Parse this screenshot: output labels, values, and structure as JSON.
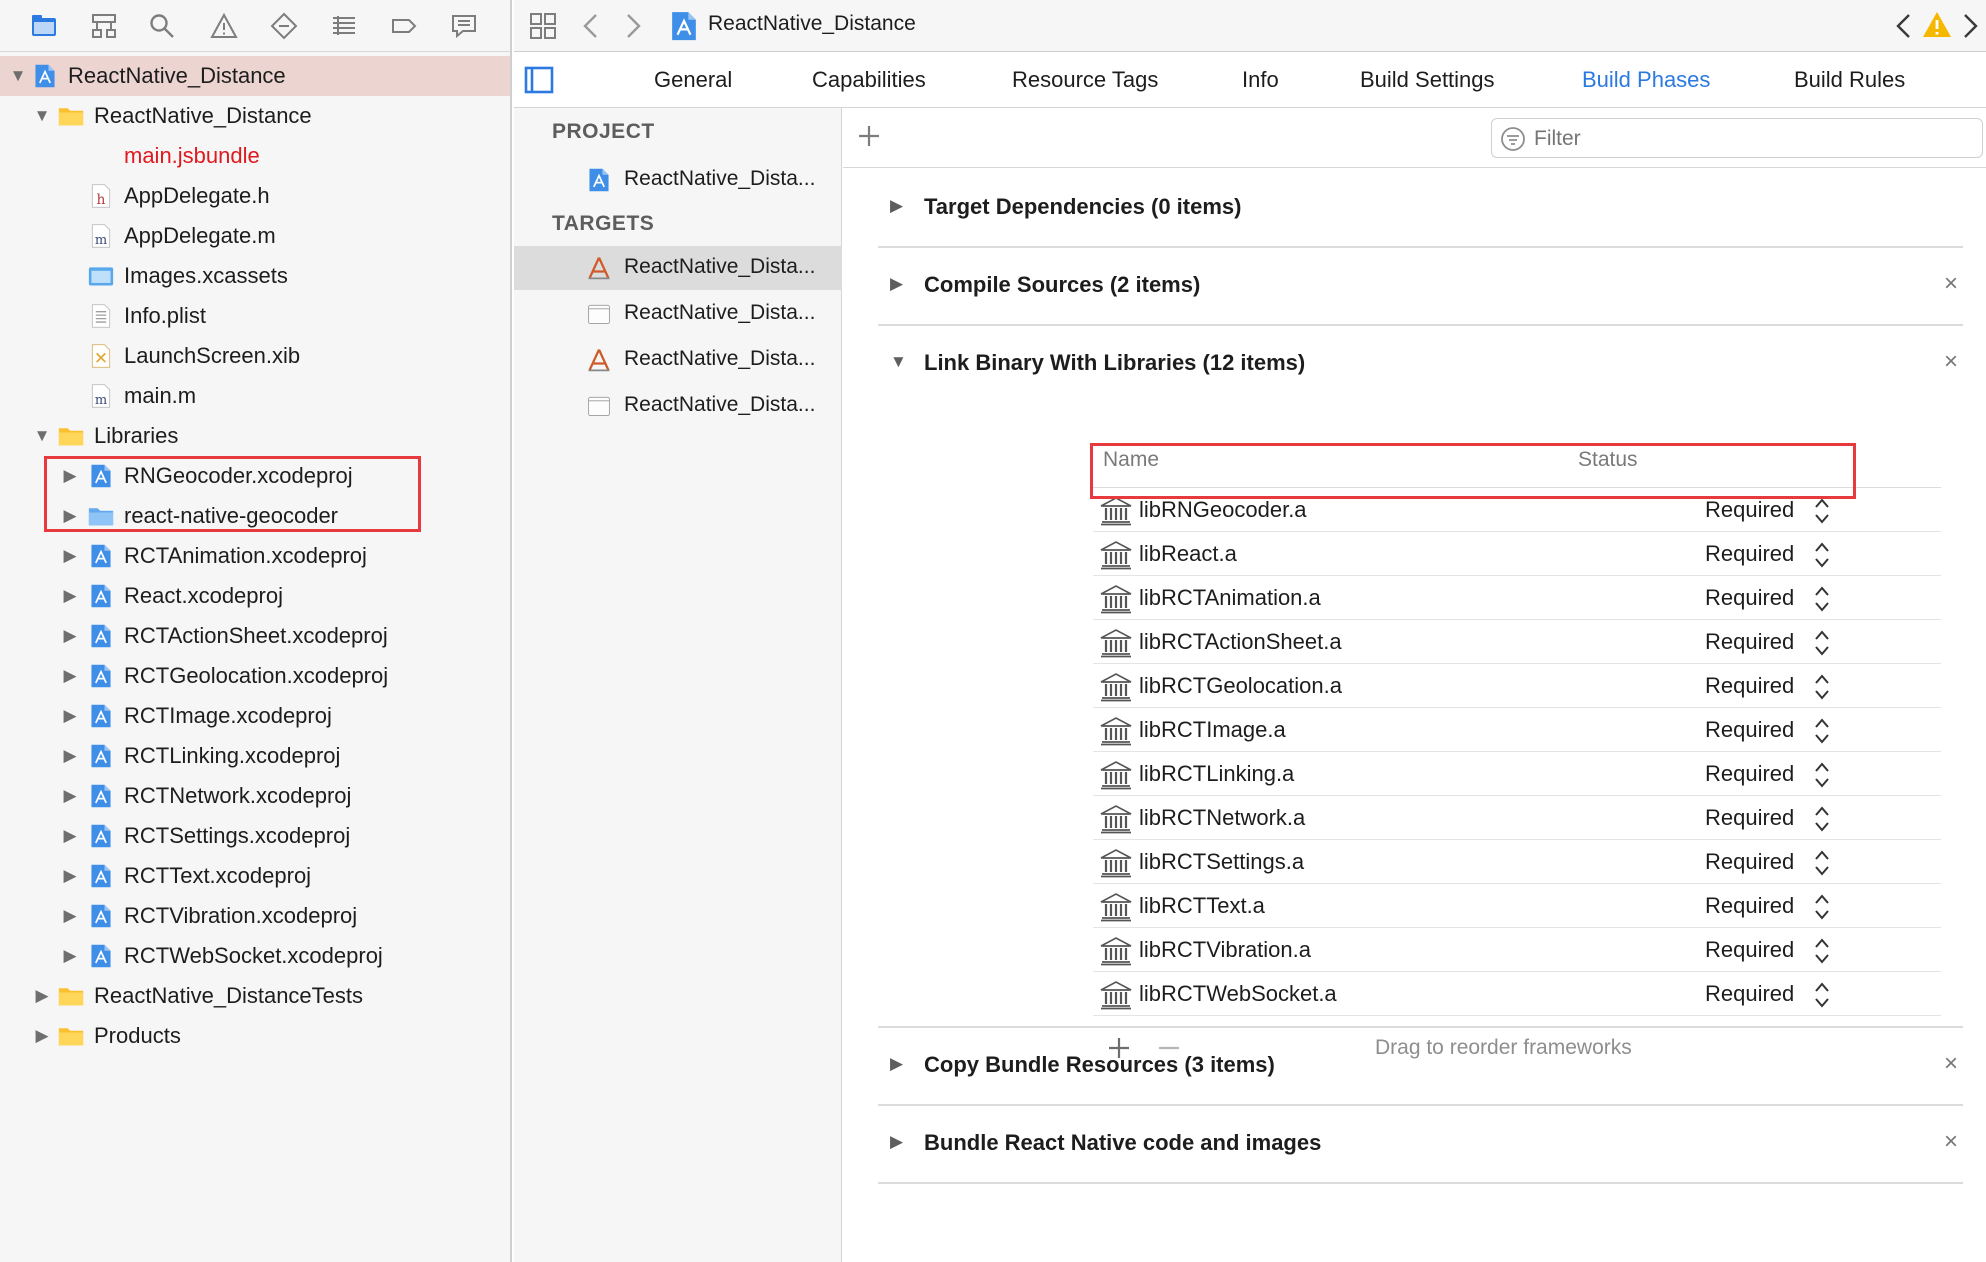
{
  "navigator": {
    "tree": [
      {
        "label": "ReactNative_Distance",
        "icon": "project-icon",
        "depth": 0,
        "disclosure": "down",
        "selected": true
      },
      {
        "label": "ReactNative_Distance",
        "icon": "folder-icon",
        "depth": 1,
        "disclosure": "down"
      },
      {
        "label": "main.jsbundle",
        "icon": "none",
        "depth": 2,
        "red": true
      },
      {
        "label": "AppDelegate.h",
        "icon": "header-file-icon",
        "depth": 2
      },
      {
        "label": "AppDelegate.m",
        "icon": "objc-file-icon",
        "depth": 2
      },
      {
        "label": "Images.xcassets",
        "icon": "asset-catalog-icon",
        "depth": 2
      },
      {
        "label": "Info.plist",
        "icon": "plist-file-icon",
        "depth": 2
      },
      {
        "label": "LaunchScreen.xib",
        "icon": "xib-file-icon",
        "depth": 2
      },
      {
        "label": "main.m",
        "icon": "objc-file-icon",
        "depth": 2
      },
      {
        "label": "Libraries",
        "icon": "folder-icon",
        "depth": 1,
        "disclosure": "down"
      },
      {
        "label": "RNGeocoder.xcodeproj",
        "icon": "project-icon",
        "depth": 2,
        "disclosure": "right"
      },
      {
        "label": "react-native-geocoder",
        "icon": "blue-folder-icon",
        "depth": 2,
        "disclosure": "right"
      },
      {
        "label": "RCTAnimation.xcodeproj",
        "icon": "project-icon",
        "depth": 2,
        "disclosure": "right"
      },
      {
        "label": "React.xcodeproj",
        "icon": "project-icon",
        "depth": 2,
        "disclosure": "right"
      },
      {
        "label": "RCTActionSheet.xcodeproj",
        "icon": "project-icon",
        "depth": 2,
        "disclosure": "right"
      },
      {
        "label": "RCTGeolocation.xcodeproj",
        "icon": "project-icon",
        "depth": 2,
        "disclosure": "right"
      },
      {
        "label": "RCTImage.xcodeproj",
        "icon": "project-icon",
        "depth": 2,
        "disclosure": "right"
      },
      {
        "label": "RCTLinking.xcodeproj",
        "icon": "project-icon",
        "depth": 2,
        "disclosure": "right"
      },
      {
        "label": "RCTNetwork.xcodeproj",
        "icon": "project-icon",
        "depth": 2,
        "disclosure": "right"
      },
      {
        "label": "RCTSettings.xcodeproj",
        "icon": "project-icon",
        "depth": 2,
        "disclosure": "right"
      },
      {
        "label": "RCTText.xcodeproj",
        "icon": "project-icon",
        "depth": 2,
        "disclosure": "right"
      },
      {
        "label": "RCTVibration.xcodeproj",
        "icon": "project-icon",
        "depth": 2,
        "disclosure": "right"
      },
      {
        "label": "RCTWebSocket.xcodeproj",
        "icon": "project-icon",
        "depth": 2,
        "disclosure": "right"
      },
      {
        "label": "ReactNative_DistanceTests",
        "icon": "folder-icon",
        "depth": 1,
        "disclosure": "right"
      },
      {
        "label": "Products",
        "icon": "folder-icon",
        "depth": 1,
        "disclosure": "right"
      }
    ]
  },
  "jumpbar": {
    "title": "ReactNative_Distance"
  },
  "tabs": [
    "General",
    "Capabilities",
    "Resource Tags",
    "Info",
    "Build Settings",
    "Build Phases",
    "Build Rules"
  ],
  "active_tab": "Build Phases",
  "targets_panel": {
    "project_heading": "PROJECT",
    "project_item": "ReactNative_Dista...",
    "targets_heading": "TARGETS",
    "targets": [
      {
        "label": "ReactNative_Dista...",
        "icon": "app-target-icon",
        "selected": true
      },
      {
        "label": "ReactNative_Dista...",
        "icon": "test-target-icon"
      },
      {
        "label": "ReactNative_Dista...",
        "icon": "app-target-icon"
      },
      {
        "label": "ReactNative_Dista...",
        "icon": "test-target-icon"
      }
    ]
  },
  "filter": {
    "placeholder": "Filter"
  },
  "phases": [
    {
      "title": "Target Dependencies (0 items)",
      "expanded": false,
      "closable": false
    },
    {
      "title": "Compile Sources (2 items)",
      "expanded": false,
      "closable": true
    },
    {
      "title": "Link Binary With Libraries (12 items)",
      "expanded": true,
      "closable": true
    },
    {
      "title": "Copy Bundle Resources (3 items)",
      "expanded": false,
      "closable": true
    },
    {
      "title": "Bundle React Native code and images",
      "expanded": false,
      "closable": true
    }
  ],
  "libraries": {
    "name_header": "Name",
    "status_header": "Status",
    "items": [
      {
        "name": "libRNGeocoder.a",
        "status": "Required"
      },
      {
        "name": "libReact.a",
        "status": "Required"
      },
      {
        "name": "libRCTAnimation.a",
        "status": "Required"
      },
      {
        "name": "libRCTActionSheet.a",
        "status": "Required"
      },
      {
        "name": "libRCTGeolocation.a",
        "status": "Required"
      },
      {
        "name": "libRCTImage.a",
        "status": "Required"
      },
      {
        "name": "libRCTLinking.a",
        "status": "Required"
      },
      {
        "name": "libRCTNetwork.a",
        "status": "Required"
      },
      {
        "name": "libRCTSettings.a",
        "status": "Required"
      },
      {
        "name": "libRCTText.a",
        "status": "Required"
      },
      {
        "name": "libRCTVibration.a",
        "status": "Required"
      },
      {
        "name": "libRCTWebSocket.a",
        "status": "Required"
      }
    ],
    "footer_hint": "Drag to reorder frameworks"
  },
  "colors": {
    "accent": "#2c7ae0",
    "highlight": "#e8393f",
    "selection": "#ecd4d0",
    "folder": "#fbc02d",
    "red_text": "#e0191e"
  }
}
